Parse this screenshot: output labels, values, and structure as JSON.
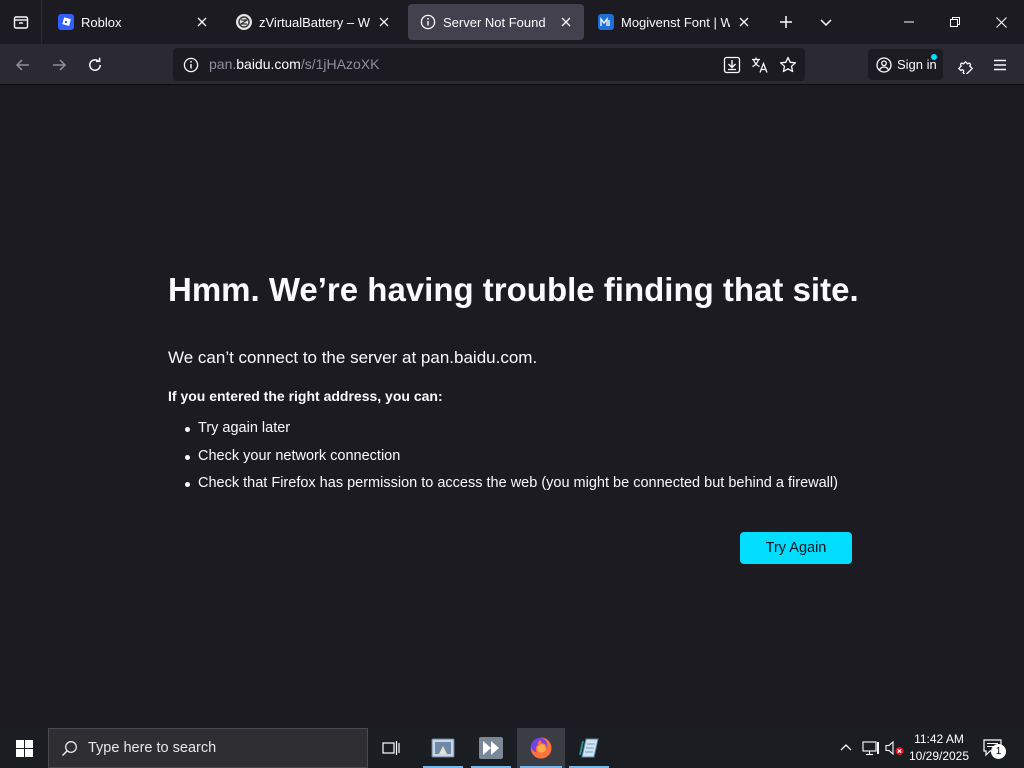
{
  "tabs": [
    {
      "title": "Roblox",
      "favicon_color": "#335fff",
      "active": false
    },
    {
      "title": "zVirtualBattery – WWW",
      "favicon_color": "#6b6b6b",
      "active": false
    },
    {
      "title": "Server Not Found",
      "favicon": "info-icon",
      "active": true
    },
    {
      "title": "Mogivenst Font | Webfo",
      "favicon_color": "#1f6fd6",
      "active": false
    }
  ],
  "navbar": {
    "url_prefix": "pan.",
    "url_host": "baidu.com",
    "url_path": "/s/1jHAzoXK",
    "signin_label": "Sign in"
  },
  "error": {
    "title": "Hmm. We’re having trouble finding that site.",
    "description": "We can’t connect to the server at pan.baidu.com.",
    "subheading": "If you entered the right address, you can:",
    "suggestions": [
      "Try again later",
      "Check your network connection",
      "Check that Firefox has permission to access the web (you might be connected but behind a firewall)"
    ],
    "button_label": "Try Again"
  },
  "taskbar": {
    "search_placeholder": "Type here to search",
    "time": "11:42 AM",
    "date": "10/29/2025",
    "notification_count": "1"
  },
  "colors": {
    "accent": "#00ddff",
    "page_bg": "#1c1b22",
    "toolbar_bg": "#2b2a33"
  }
}
